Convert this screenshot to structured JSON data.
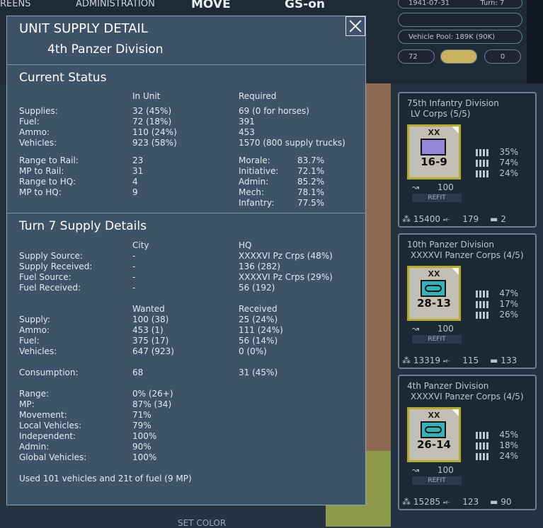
{
  "top": {
    "menu1": "REENS",
    "menu2": "ADMINISTRATION",
    "menu3": "MOVE",
    "menu4": "GS-on",
    "date": "1941-07-31",
    "turn": "Turn: 7",
    "vehicle_pool": "Vehicle Pool: 189K (90K)",
    "field_72": "72",
    "field_0": "0"
  },
  "dialog": {
    "title": "UNIT SUPPLY DETAIL",
    "unit": "4th Panzer Division",
    "status_heading": "Current Status",
    "col_in_unit": "In Unit",
    "col_required": "Required",
    "status_rows": [
      {
        "label": "Supplies:",
        "in_unit": "32 (45%)",
        "required": "69 (0 for horses)"
      },
      {
        "label": "Fuel:",
        "in_unit": "72 (18%)",
        "required": "391"
      },
      {
        "label": "Ammo:",
        "in_unit": "110 (24%)",
        "required": "453"
      },
      {
        "label": "Vehicles:",
        "in_unit": "923 (58%)",
        "required": "1570 (800 supply trucks)"
      }
    ],
    "range_rows": [
      {
        "label": "Range to Rail:",
        "value": "23",
        "label2": "Morale:",
        "value2": "83.7%"
      },
      {
        "label": "MP to Rail:",
        "value": "31",
        "label2": "Initiative:",
        "value2": "72.1%"
      },
      {
        "label": "Range to HQ:",
        "value": "4",
        "label2": "Admin:",
        "value2": "85.2%"
      },
      {
        "label": "MP to HQ:",
        "value": "9",
        "label2": "Mech:",
        "value2": "78.1%"
      },
      {
        "label": "",
        "value": "",
        "label2": "Infantry:",
        "value2": "77.5%"
      }
    ],
    "turn_heading": "Turn 7 Supply Details",
    "col_city": "City",
    "col_hq": "HQ",
    "source_rows": [
      {
        "label": "Supply Source:",
        "city": "-",
        "hq": "XXXXVI Pz Crps (48%)"
      },
      {
        "label": "Supply Received:",
        "city": "-",
        "hq": "136 (282)"
      },
      {
        "label": "Fuel Source:",
        "city": "-",
        "hq": "XXXXVI Pz Crps (29%)"
      },
      {
        "label": "Fuel Received:",
        "city": "-",
        "hq": "56 (192)"
      }
    ],
    "col_wanted": "Wanted",
    "col_received": "Received",
    "wanted_rows": [
      {
        "label": "Supply:",
        "wanted": "100 (38)",
        "received": "25 (24%)"
      },
      {
        "label": "Ammo:",
        "wanted": "453 (1)",
        "received": "111 (24%)"
      },
      {
        "label": "Fuel:",
        "wanted": "375 (17)",
        "received": "56 (14%)"
      },
      {
        "label": "Vehicles:",
        "wanted": "647 (923)",
        "received": "0 (0%)"
      }
    ],
    "consumption_label": "Consumption:",
    "consumption_wanted": "68",
    "consumption_received": "31 (45%)",
    "factor_rows": [
      {
        "label": "Range:",
        "value": "0% (26+)"
      },
      {
        "label": "MP:",
        "value": "87% (34)"
      },
      {
        "label": "Movement:",
        "value": "71%"
      },
      {
        "label": "Local Vehicles:",
        "value": "79%"
      },
      {
        "label": "Independent:",
        "value": "100%"
      },
      {
        "label": "Admin:",
        "value": "90%"
      },
      {
        "label": "Global Vehicles:",
        "value": "100%"
      }
    ],
    "footer": "Used 101 vehicles and 21t of fuel (9 MP)"
  },
  "cards": [
    {
      "name": "75th Infantry Division",
      "corps": "LV Corps (5/5)",
      "number": "16-9",
      "xx": "XX",
      "type": "infantry",
      "p1": "35%",
      "p2": "74%",
      "p3": "24%",
      "supply": "100",
      "refit": "REFIT",
      "men": "15400",
      "guns": "179",
      "tanks": "2"
    },
    {
      "name": "10th Panzer Division",
      "corps": "XXXXVI Panzer Corps (4/5)",
      "number": "28-13",
      "xx": "XX",
      "type": "panzer",
      "p1": "47%",
      "p2": "17%",
      "p3": "26%",
      "supply": "100",
      "refit": "REFIT",
      "men": "13319",
      "guns": "115",
      "tanks": "133"
    },
    {
      "name": "4th Panzer Division",
      "corps": "XXXXVI Panzer Corps (4/5)",
      "number": "26-14",
      "xx": "XX",
      "type": "panzer",
      "p1": "45%",
      "p2": "18%",
      "p3": "24%",
      "supply": "100",
      "refit": "REFIT",
      "men": "15285",
      "guns": "123",
      "tanks": "90"
    }
  ],
  "bottom": {
    "set_color": "SET COLOR"
  },
  "colors": {
    "dialog_bg": "#3e5368",
    "unit_frame": "#b5ac2c",
    "infantry": "#9585d6",
    "panzer": "#2fb2b8"
  }
}
